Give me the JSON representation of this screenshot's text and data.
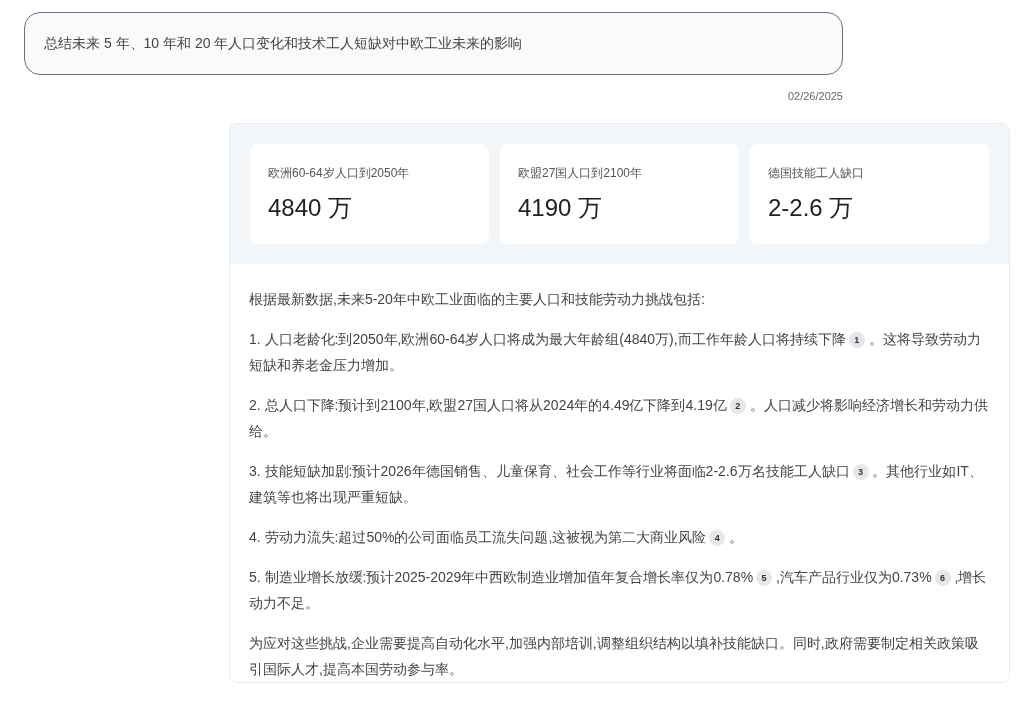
{
  "query": {
    "text": "总结未来 5 年、10 年和 20 年人口变化和技术工人短缺对中欧工业未来的影响"
  },
  "date": "02/26/2025",
  "stats": [
    {
      "label": "欧洲60-64岁人口到2050年",
      "value": "4840 万"
    },
    {
      "label": "欧盟27国人口到2100年",
      "value": "4190 万"
    },
    {
      "label": "德国技能工人缺口",
      "value": "2-2.6 万"
    }
  ],
  "paragraphs": [
    [
      {
        "kind": "text",
        "text": "根据最新数据,未来5-20年中欧工业面临的主要人口和技能劳动力挑战包括:"
      }
    ],
    [
      {
        "kind": "text",
        "text": "1. 人口老龄化:到2050年,欧洲60-64岁人口将成为最大年龄组(4840万),而工作年龄人口将持续下降"
      },
      {
        "kind": "citation",
        "text": "1"
      },
      {
        "kind": "text",
        "text": " 。这将导致劳动力短缺和养老金压力增加。"
      }
    ],
    [
      {
        "kind": "text",
        "text": "2. 总人口下降:预计到2100年,欧盟27国人口将从2024年的4.49亿下降到4.19亿"
      },
      {
        "kind": "citation",
        "text": "2"
      },
      {
        "kind": "text",
        "text": " 。人口减少将影响经济增长和劳动力供给。"
      }
    ],
    [
      {
        "kind": "text",
        "text": "3. 技能短缺加剧:预计2026年德国销售、儿童保育、社会工作等行业将面临2-2.6万名技能工人缺口"
      },
      {
        "kind": "citation",
        "text": "3"
      },
      {
        "kind": "text",
        "text": " 。其他行业如IT、建筑等也将出现严重短缺。"
      }
    ],
    [
      {
        "kind": "text",
        "text": "4. 劳动力流失:超过50%的公司面临员工流失问题,这被视为第二大商业风险"
      },
      {
        "kind": "citation",
        "text": "4"
      },
      {
        "kind": "text",
        "text": " 。"
      }
    ],
    [
      {
        "kind": "text",
        "text": "5. 制造业增长放缓:预计2025-2029年中西欧制造业增加值年复合增长率仅为0.78%"
      },
      {
        "kind": "citation",
        "text": "5"
      },
      {
        "kind": "text",
        "text": " ,汽车产品行业仅为0.73%"
      },
      {
        "kind": "citation",
        "text": "6"
      },
      {
        "kind": "text",
        "text": " ,增长动力不足。"
      }
    ],
    [
      {
        "kind": "text",
        "text": "为应对这些挑战,企业需要提高自动化水平,加强内部培训,调整组织结构以填补技能缺口。同时,政府需要制定相关政策吸引国际人才,提高本国劳动参与率。"
      }
    ]
  ]
}
